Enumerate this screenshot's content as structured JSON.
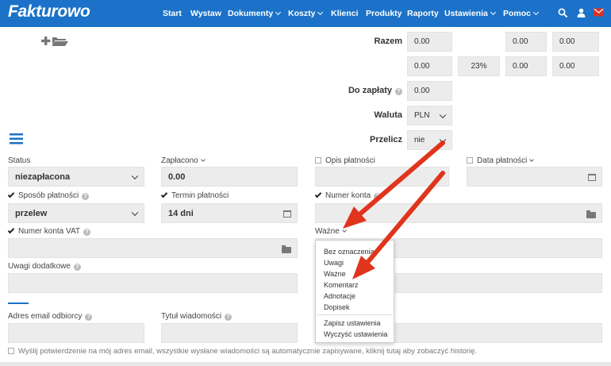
{
  "navbar": {
    "brand": "Fakturowo",
    "items": [
      "Start",
      "Wystaw",
      "Dokumenty",
      "Koszty",
      "Klienci",
      "Produkty",
      "Raporty",
      "Ustawienia",
      "Pomoc"
    ],
    "bg_color": "#1b72c8",
    "icons": [
      "search-icon",
      "user-icon",
      "mail-icon"
    ]
  },
  "totals": {
    "razem_label": "Razem",
    "razem_value": "0.00",
    "razem_col3": "0.00",
    "razem_col4": "0.00",
    "row2_col1": "0.00",
    "row2_vat": "23%",
    "row2_col3": "0.00",
    "row2_col4": "0.00",
    "do_zaplaty_label": "Do zapłaty",
    "do_zaplaty_value": "0.00",
    "waluta_label": "Waluta",
    "waluta_value": "PLN",
    "przelicz_label": "Przelicz",
    "przelicz_value": "nie"
  },
  "form": {
    "status_label": "Status",
    "status_value": "niezapłacona",
    "zaplacono_label": "Zapłacono",
    "zaplacono_value": "0.00",
    "opis_label": "Opis płatności",
    "data_platnosci_label": "Data płatności",
    "sposob_label": "Sposób płatności",
    "sposob_value": "przelew",
    "termin_label": "Termin płatności",
    "termin_value": "14 dni",
    "numer_konta_label": "Numer konta",
    "numer_konta_vat_label": "Numer konta VAT",
    "wazne_label": "Ważne",
    "uwagi_label": "Uwagi dodatkowe",
    "email_label": "Adres email odbiorcy",
    "tytul_label": "Tytuł wiadomości",
    "confirm_text": "Wyślij potwierdzenie na mój adres email, wszystkie wysłane wiadomości są automatycznie zapisywane, kliknij tutaj aby zobaczyć historię."
  },
  "dropdown": {
    "items": [
      "Bez oznaczenia",
      "Uwagi",
      "Ważne",
      "Komentarz",
      "Adnotacje",
      "Dopisek"
    ],
    "actions": [
      "Zapisz ustawienia",
      "Wyczyść ustawienia"
    ]
  },
  "colors": {
    "arrow": "#e0341c",
    "accent": "#1b72c8"
  }
}
